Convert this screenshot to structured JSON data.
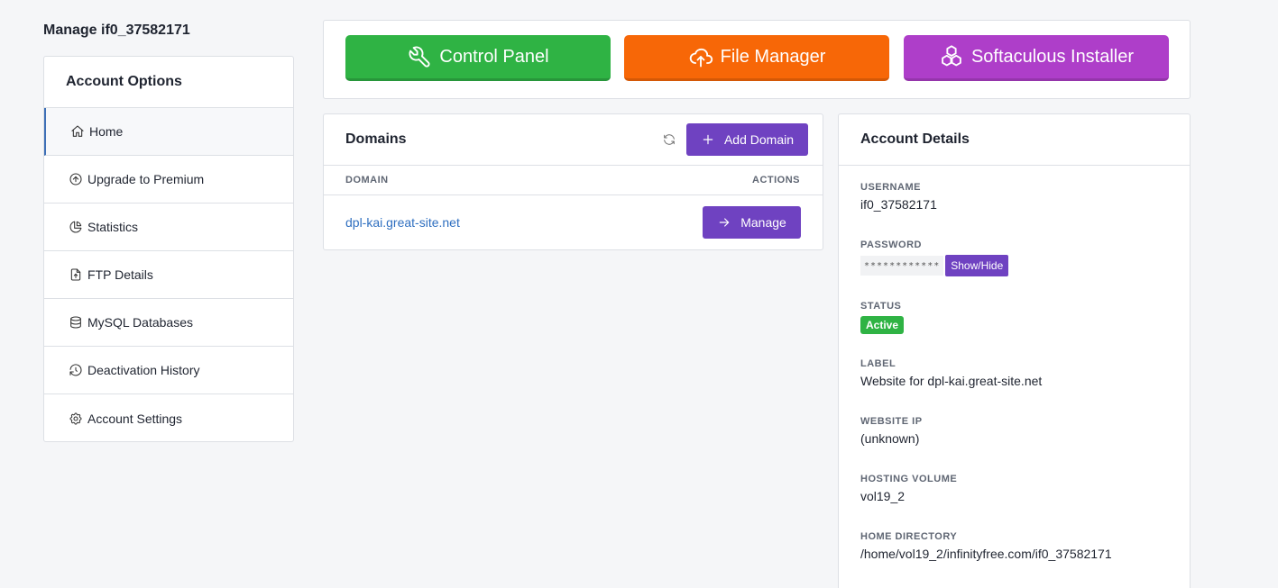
{
  "page": {
    "title": "Manage if0_37582171"
  },
  "sidebar": {
    "title": "Account Options",
    "items": [
      {
        "label": "Home",
        "icon": "home-icon"
      },
      {
        "label": "Upgrade to Premium",
        "icon": "arrow-up-circle-icon"
      },
      {
        "label": "Statistics",
        "icon": "chart-pie-icon"
      },
      {
        "label": "FTP Details",
        "icon": "file-upload-icon"
      },
      {
        "label": "MySQL Databases",
        "icon": "database-icon"
      },
      {
        "label": "Deactivation History",
        "icon": "history-icon"
      },
      {
        "label": "Account Settings",
        "icon": "settings-icon"
      }
    ]
  },
  "quick_links": {
    "control_panel": "Control Panel",
    "file_manager": "File Manager",
    "softaculous": "Softaculous Installer"
  },
  "domains": {
    "title": "Domains",
    "add_button": "Add Domain",
    "columns": {
      "domain": "DOMAIN",
      "actions": "ACTIONS"
    },
    "rows": [
      {
        "domain": "dpl-kai.great-site.net",
        "action": "Manage"
      }
    ]
  },
  "account_details": {
    "title": "Account Details",
    "username_label": "USERNAME",
    "username": "if0_37582171",
    "password_label": "PASSWORD",
    "password_mask": "************",
    "show_hide": "Show/Hide",
    "status_label": "STATUS",
    "status": "Active",
    "label_label": "LABEL",
    "label": "Website for dpl-kai.great-site.net",
    "ip_label": "WEBSITE IP",
    "ip": "(unknown)",
    "volume_label": "HOSTING VOLUME",
    "volume": "vol19_2",
    "home_dir_label": "HOME DIRECTORY",
    "home_dir": "/home/vol19_2/infinityfree.com/if0_37582171"
  },
  "colors": {
    "control_panel": "#2fb344",
    "file_manager": "#f76707",
    "softaculous": "#ae3ec9",
    "primary": "#6f42c1",
    "status_active": "#2fb344",
    "link": "#2f6fc0"
  }
}
